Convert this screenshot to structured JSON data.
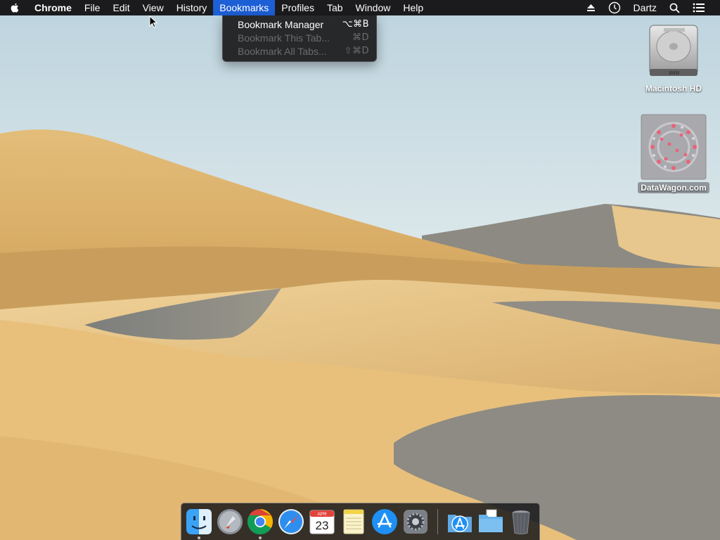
{
  "menubar": {
    "apple_icon": "apple-icon",
    "app_name": "Chrome",
    "items": [
      "File",
      "Edit",
      "View",
      "History",
      "Bookmarks",
      "Profiles",
      "Tab",
      "Window",
      "Help"
    ],
    "active_item": "Bookmarks",
    "status": {
      "eject_icon": "eject-icon",
      "clock_icon": "time-machine-icon",
      "user": "Dartz",
      "search_icon": "spotlight-search-icon",
      "list_icon": "notification-center-icon"
    }
  },
  "bookmarks_menu": {
    "items": [
      {
        "label": "Bookmark Manager",
        "shortcut": "⌥⌘B",
        "enabled": true
      },
      {
        "label": "Bookmark This Tab...",
        "shortcut": "⌘D",
        "enabled": false
      },
      {
        "label": "Bookmark All Tabs...",
        "shortcut": "⇧⌘D",
        "enabled": false
      }
    ]
  },
  "desktop": {
    "icons": [
      {
        "label": "Macintosh HD",
        "icon": "hard-drive-icon"
      },
      {
        "label": "DataWagon.com",
        "icon": "network-volume-icon"
      }
    ]
  },
  "dock": {
    "apps": [
      {
        "name": "finder-icon",
        "running": true
      },
      {
        "name": "launchpad-icon",
        "running": false
      },
      {
        "name": "chrome-icon",
        "running": true
      },
      {
        "name": "safari-icon",
        "running": false
      },
      {
        "name": "calendar-icon",
        "running": false,
        "month": "APR",
        "day": "23"
      },
      {
        "name": "notes-icon",
        "running": false
      },
      {
        "name": "app-store-icon",
        "running": false
      },
      {
        "name": "system-preferences-icon",
        "running": false
      }
    ],
    "stacks": [
      {
        "name": "applications-folder-icon"
      },
      {
        "name": "downloads-folder-icon"
      },
      {
        "name": "trash-icon"
      }
    ]
  },
  "colors": {
    "menubar_bg": "#1b1b1d",
    "menu_highlight": "#1d5fd6",
    "sky_top": "#c9dde6",
    "sand_light": "#e9c888",
    "sand_shadow": "#8d8b83"
  }
}
